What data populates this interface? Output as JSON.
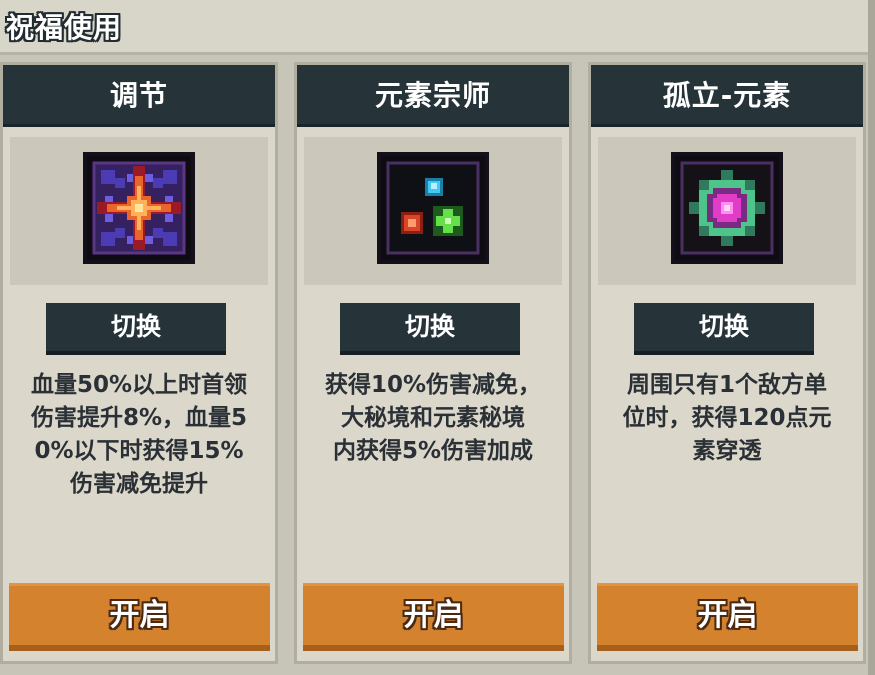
{
  "window": {
    "title": "祝福使用"
  },
  "cards": [
    {
      "title": "调节",
      "icon": "orange-star-on-purple-grid-icon",
      "switch_label": "切换",
      "description": "血量50%以上时首领\n伤害提升8%，血量5\n0%以下时获得15%\n伤害减免提升",
      "open_label": "开启"
    },
    {
      "title": "元素宗师",
      "icon": "three-element-gems-icon",
      "switch_label": "切换",
      "description": "获得10%伤害减免，\n大秘境和元素秘境\n内获得5%伤害加成",
      "open_label": "开启"
    },
    {
      "title": "孤立-元素",
      "icon": "magenta-green-burst-icon",
      "switch_label": "切换",
      "description": "周围只有1个敌方单\n位时，获得120点元\n素穿透",
      "open_label": "开启"
    }
  ],
  "colors": {
    "header_dark": "#26343a",
    "button_orange": "#d4822e",
    "card_bg": "#dbd8cb"
  }
}
